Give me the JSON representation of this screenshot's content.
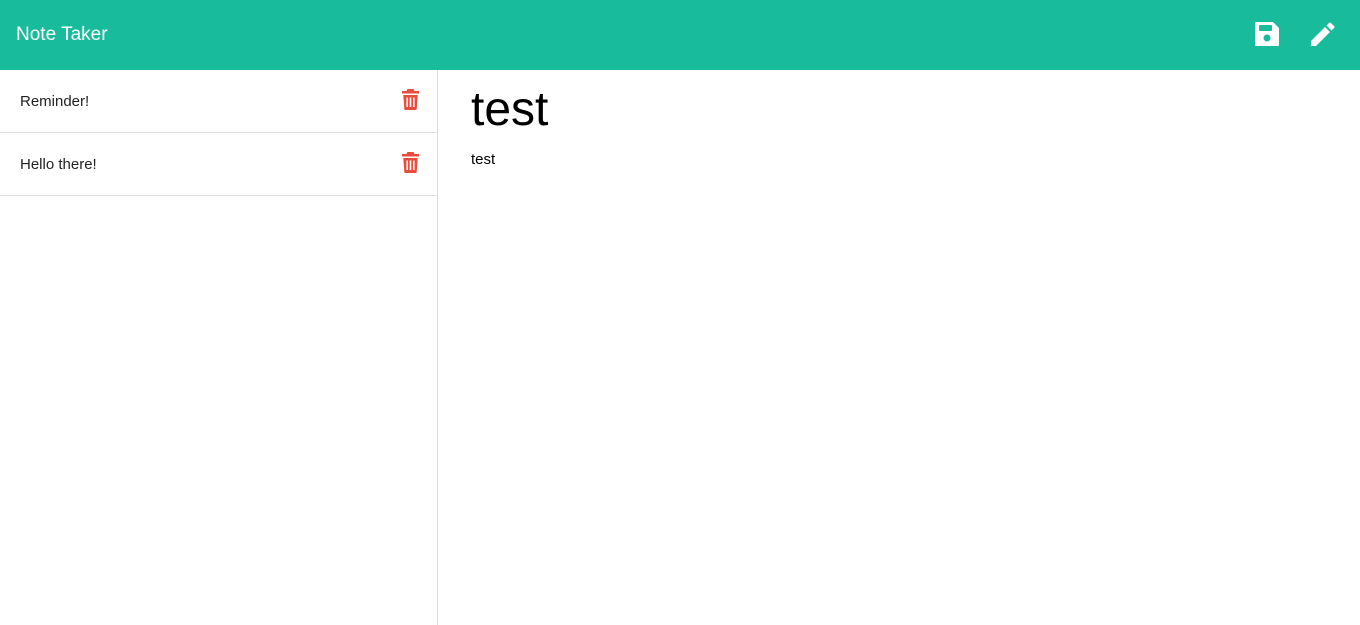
{
  "app": {
    "brand": "Note Taker"
  },
  "toolbar": {
    "save_icon": "floppy-disk-icon",
    "new_note_icon": "pencil-icon"
  },
  "notes": [
    {
      "title": "Reminder!",
      "delete_icon": "trash-icon"
    },
    {
      "title": "Hello there!",
      "delete_icon": "trash-icon"
    }
  ],
  "active_note": {
    "title": "test",
    "text": "test"
  },
  "colors": {
    "navbar": "#18bc9c",
    "delete": "#e74c3c",
    "divider": "#dddddd"
  }
}
